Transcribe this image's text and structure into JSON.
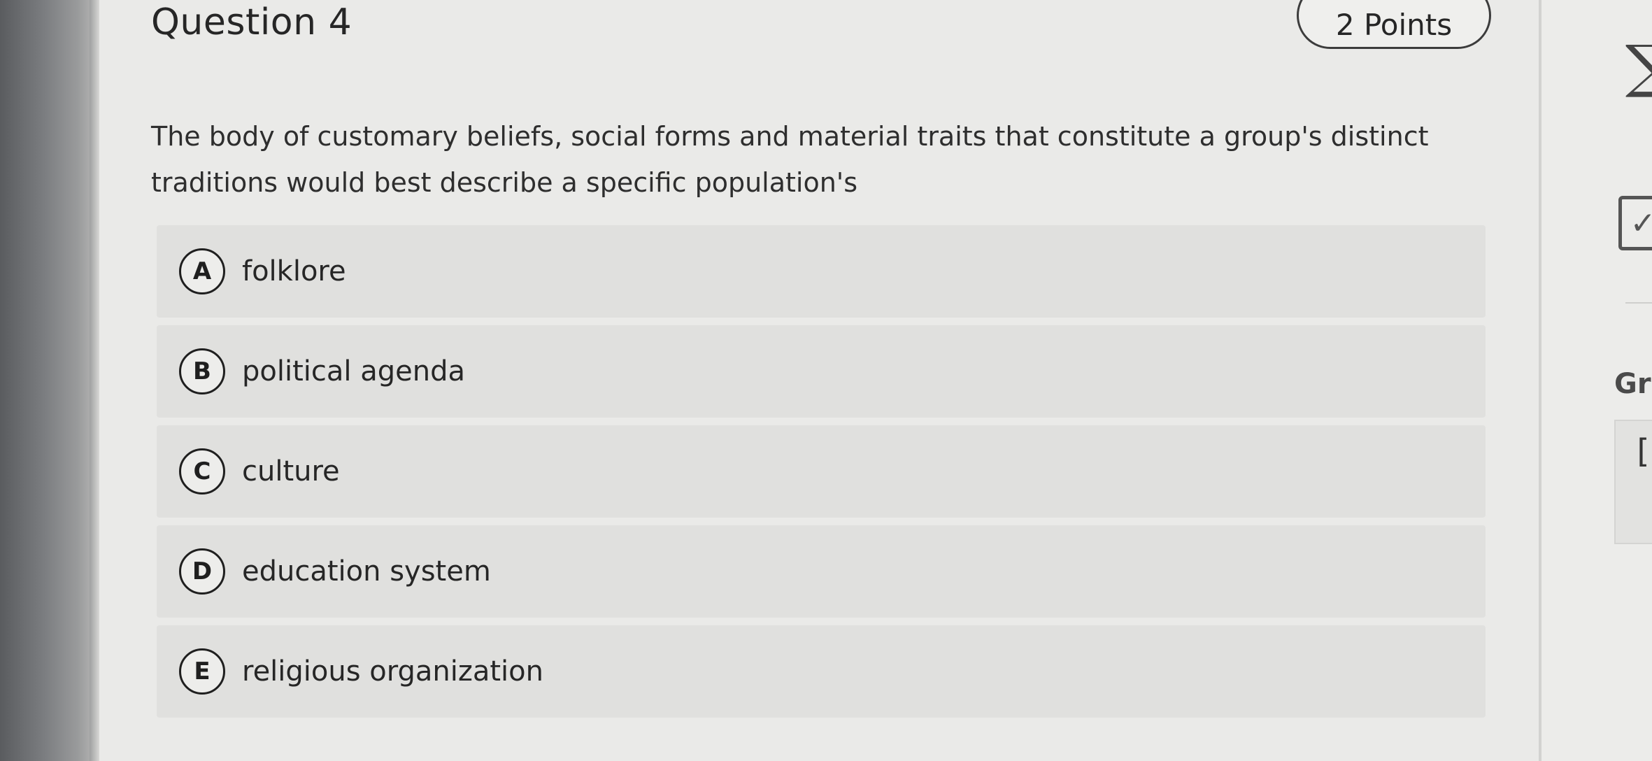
{
  "question": {
    "title": "Question 4",
    "points": "2 Points",
    "prompt": "The body of customary beliefs, social forms and material traits that constitute a group's distinct traditions would best describe a specific population's"
  },
  "options": [
    {
      "letter": "A",
      "text": "folklore"
    },
    {
      "letter": "B",
      "text": "political agenda"
    },
    {
      "letter": "C",
      "text": "culture"
    },
    {
      "letter": "D",
      "text": "education system"
    },
    {
      "letter": "E",
      "text": "religious organization"
    }
  ],
  "sidebar": {
    "sigma_icon": "sigma-icon",
    "check_icon": "checkbox-icon",
    "grade_label": "Gr"
  }
}
